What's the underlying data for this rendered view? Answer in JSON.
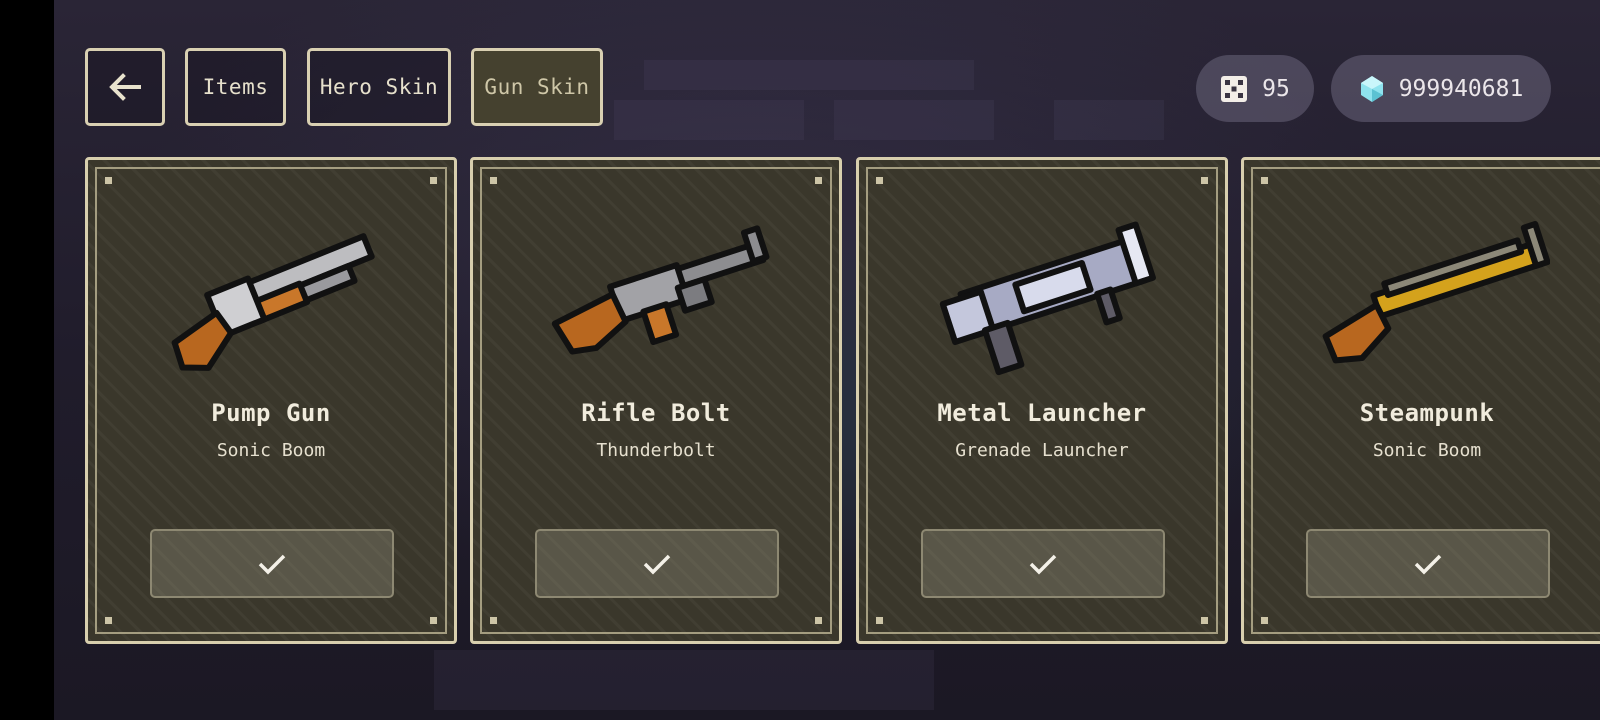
{
  "nav": {
    "back_icon": "arrow-left-icon",
    "tabs": [
      {
        "label": "Items",
        "active": false
      },
      {
        "label": "Hero Skin",
        "active": false
      },
      {
        "label": "Gun Skin",
        "active": true
      }
    ]
  },
  "currency": {
    "dice": {
      "icon": "dice-icon",
      "value": "95"
    },
    "gems": {
      "icon": "gem-icon",
      "value": "999940681"
    }
  },
  "cards": [
    {
      "name": "Pump Gun",
      "subtitle": "Sonic Boom",
      "icon": "pump-gun-icon",
      "action_icon": "checkmark-icon"
    },
    {
      "name": "Rifle Bolt",
      "subtitle": "Thunderbolt",
      "icon": "rifle-bolt-icon",
      "action_icon": "checkmark-icon"
    },
    {
      "name": "Metal Launcher",
      "subtitle": "Grenade Launcher",
      "icon": "metal-launcher-icon",
      "action_icon": "checkmark-icon"
    },
    {
      "name": "Steampunk",
      "subtitle": "Sonic Boom",
      "icon": "steampunk-gun-icon",
      "action_icon": "checkmark-icon"
    }
  ],
  "colors": {
    "card_border": "#d8cfae",
    "card_bg": "#3a372b",
    "active_tab_bg": "#45412f",
    "gem": "#8fe3ee"
  }
}
